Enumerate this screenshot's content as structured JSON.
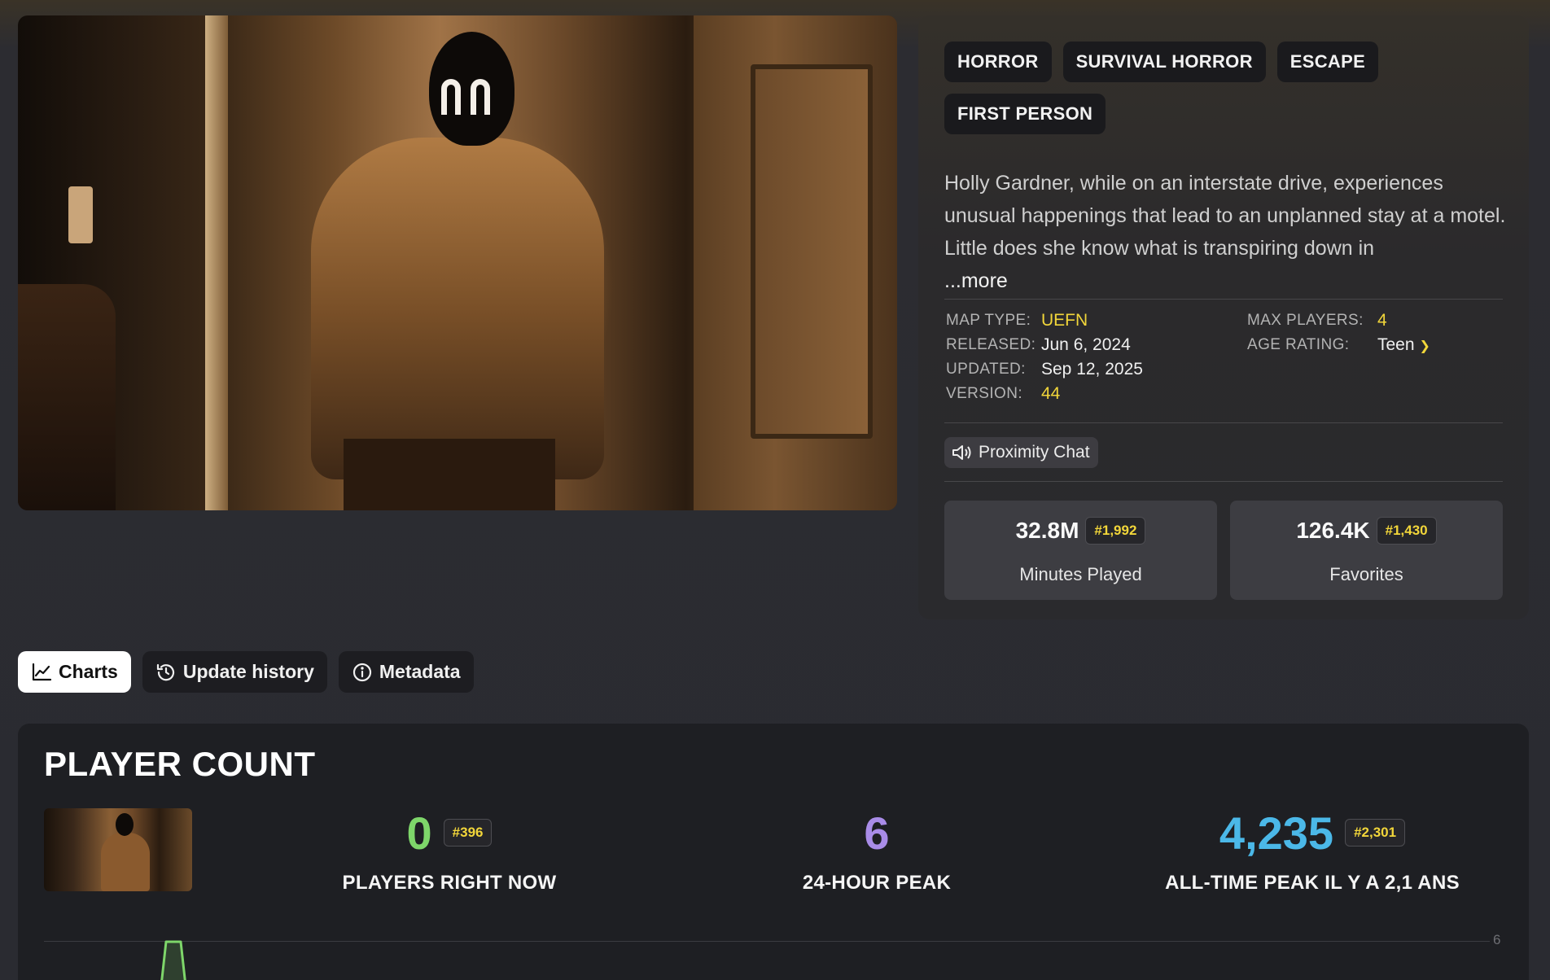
{
  "tags": [
    "HORROR",
    "SURVIVAL HORROR",
    "ESCAPE",
    "FIRST PERSON"
  ],
  "description": "Holly Gardner, while on an interstate drive, experiences unusual happenings that lead to an unplanned stay at a motel. Little does she know what is transpiring down in",
  "more_label": "...more",
  "meta": {
    "map_type_label": "MAP TYPE:",
    "map_type": "UEFN",
    "released_label": "RELEASED:",
    "released": "Jun 6, 2024",
    "updated_label": "UPDATED:",
    "updated": "Sep 12, 2025",
    "version_label": "VERSION:",
    "version": "44",
    "max_players_label": "MAX PLAYERS:",
    "max_players": "4",
    "age_rating_label": "AGE RATING:",
    "age_rating": "Teen"
  },
  "features": {
    "proximity_chat": "Proximity Chat"
  },
  "stats": {
    "minutes_played": {
      "value": "32.8M",
      "rank": "#1,992",
      "label": "Minutes Played"
    },
    "favorites": {
      "value": "126.4K",
      "rank": "#1,430",
      "label": "Favorites"
    }
  },
  "tabs": {
    "charts": "Charts",
    "update_history": "Update history",
    "metadata": "Metadata"
  },
  "player_count": {
    "title": "PLAYER COUNT",
    "now": {
      "value": "0",
      "rank": "#396",
      "label": "PLAYERS RIGHT NOW"
    },
    "peak_24h": {
      "value": "6",
      "label": "24-HOUR PEAK"
    },
    "all_time": {
      "value": "4,235",
      "rank": "#2,301",
      "label": "ALL-TIME PEAK IL Y A 2,1 ANS"
    },
    "y_axis_max_label": "6"
  },
  "colors": {
    "accent_yellow": "#f2d63a",
    "now_green": "#7ed66a",
    "peak_purple": "#a98ce8",
    "alltime_blue": "#4bb8e8"
  }
}
